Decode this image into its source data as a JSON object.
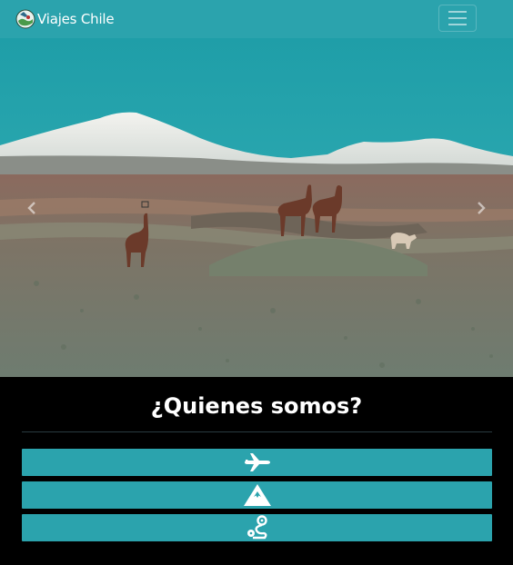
{
  "navbar": {
    "brand_text": "Viajes Chile",
    "logo_icon": "chile-map-logo-icon",
    "menu_icon": "hamburger-menu-icon",
    "color": "#2ba3ad"
  },
  "hero": {
    "image_icon": "altiplano-llamas-photo",
    "prev_icon": "chevron-left-icon",
    "next_icon": "chevron-right-icon"
  },
  "about": {
    "title": "¿Quienes somos?",
    "buttons": [
      {
        "icon": "airplane-icon"
      },
      {
        "icon": "mountain-icon"
      },
      {
        "icon": "route-icon"
      }
    ],
    "button_color": "#2ba3ad"
  }
}
